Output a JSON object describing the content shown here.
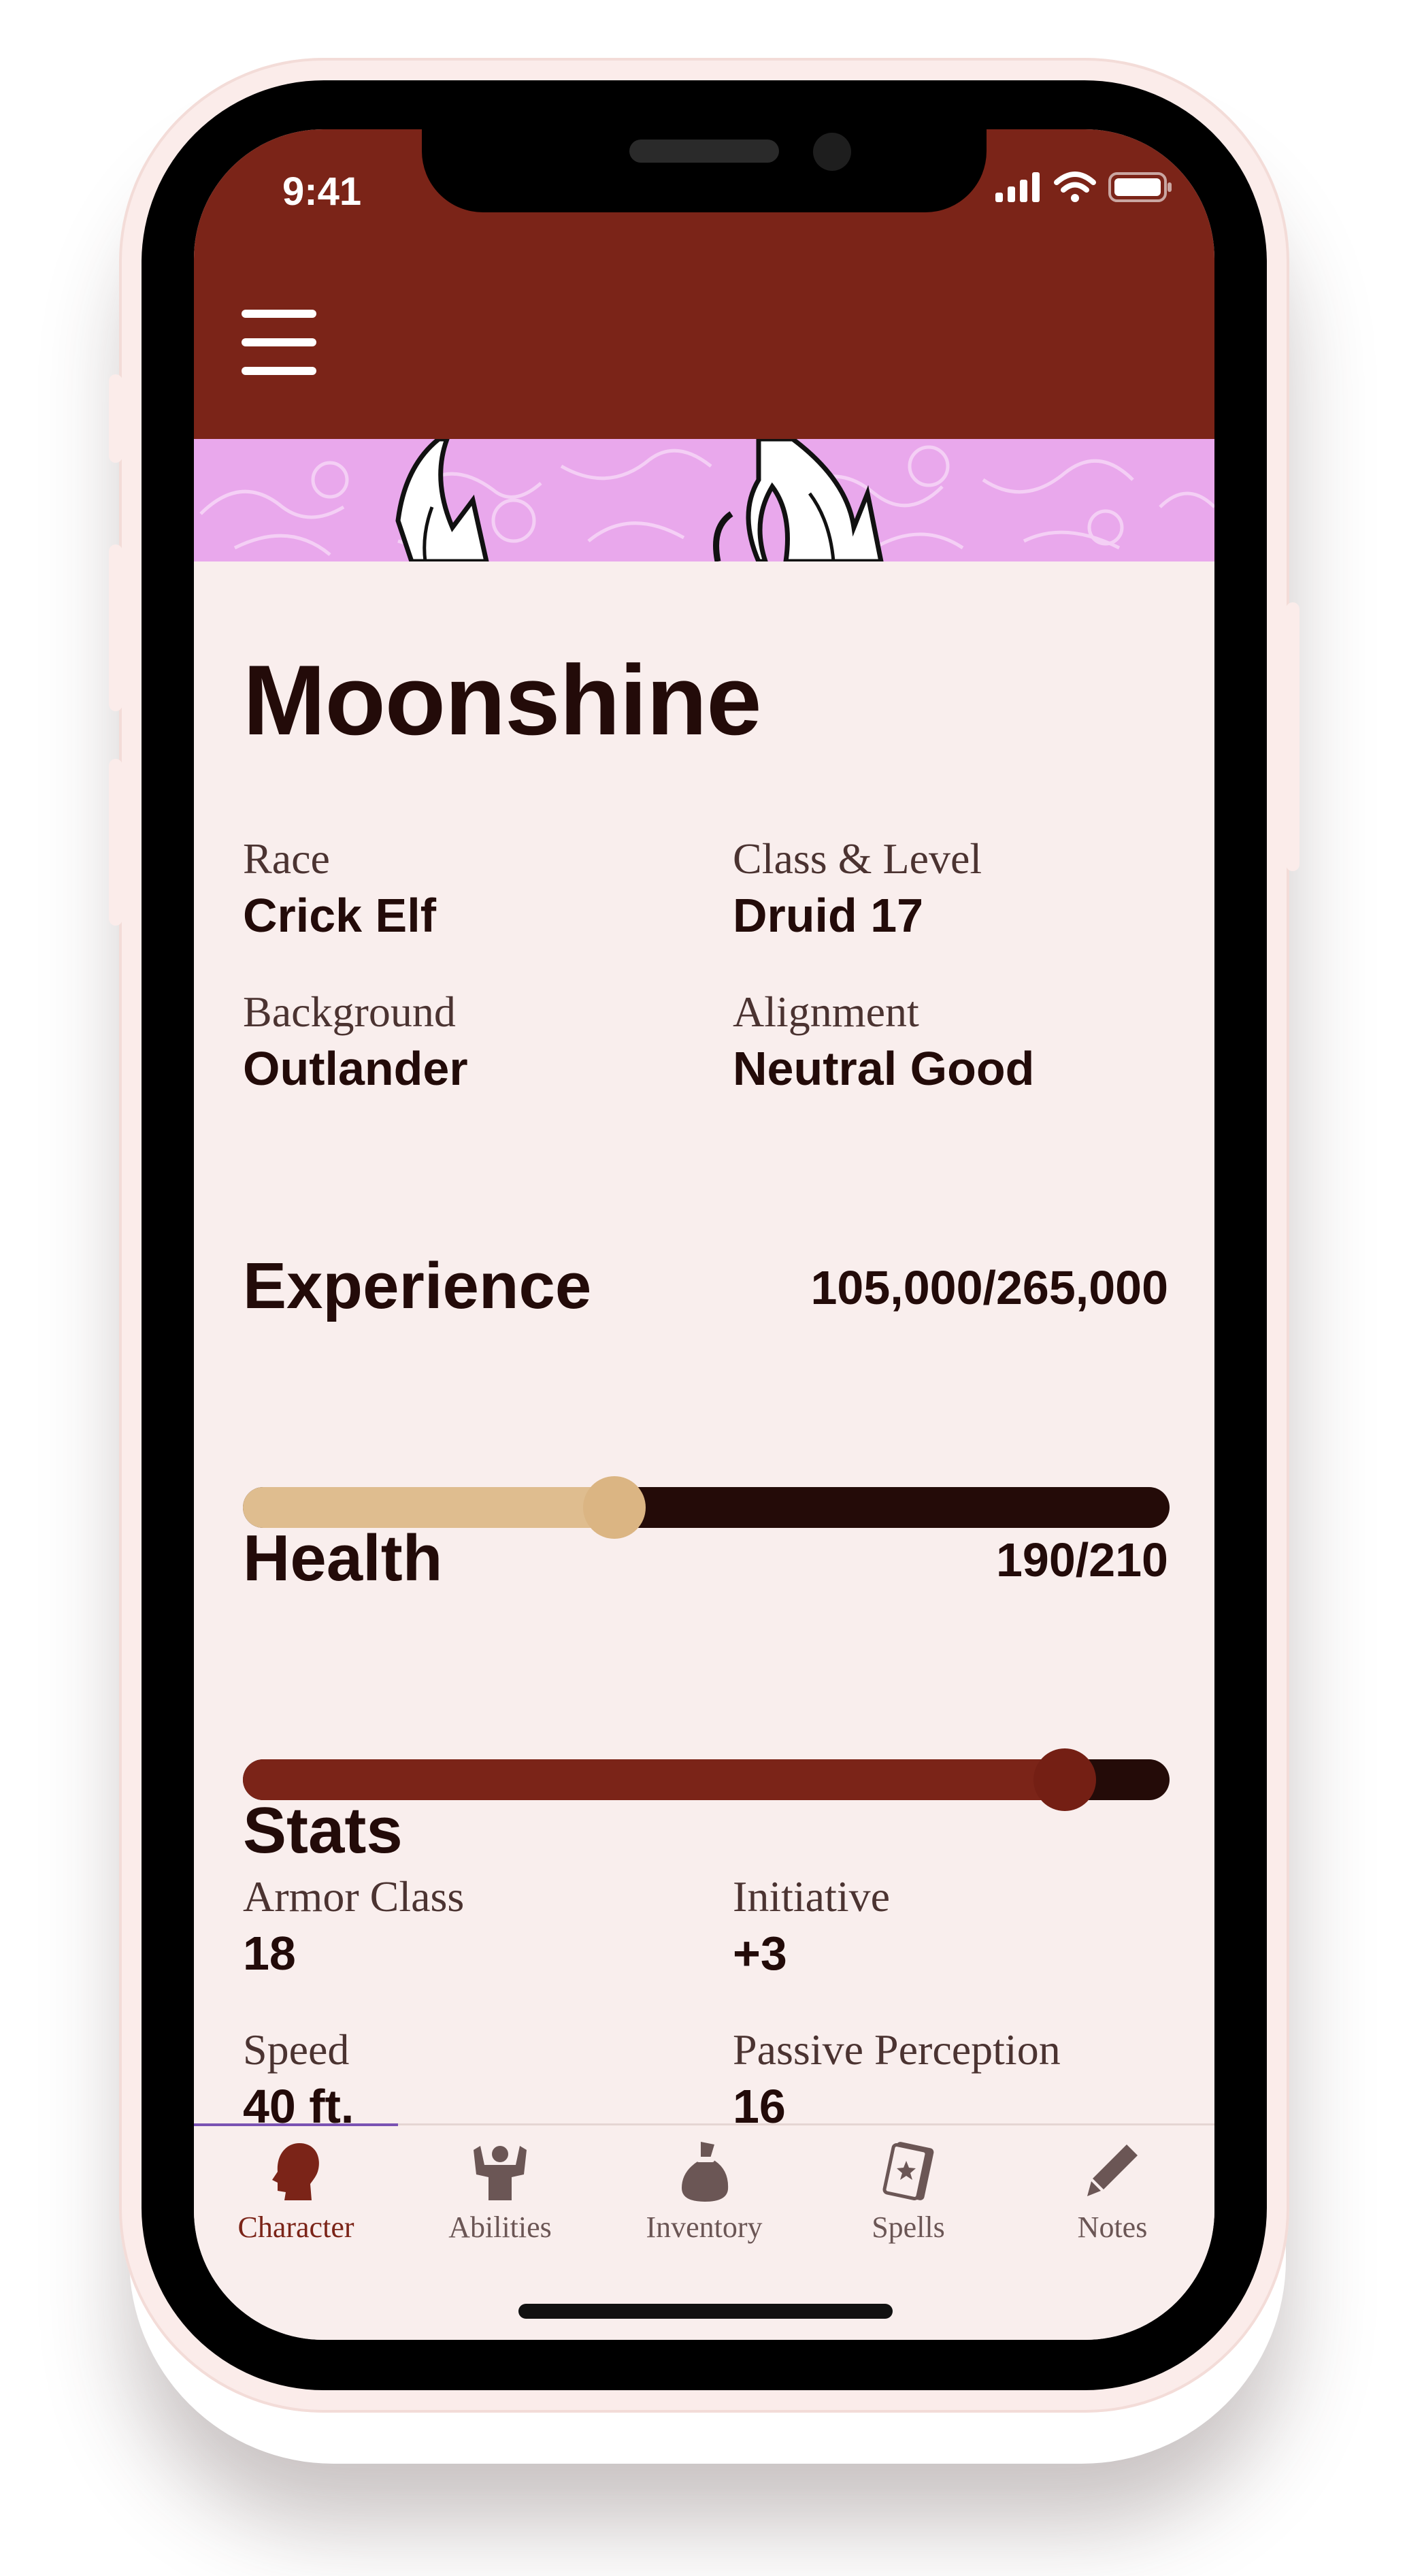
{
  "status_bar": {
    "time": "9:41"
  },
  "character": {
    "name": "Moonshine",
    "details": [
      {
        "label": "Race",
        "value": "Crick Elf"
      },
      {
        "label": "Class & Level",
        "value": "Druid 17"
      },
      {
        "label": "Background",
        "value": "Outlander"
      },
      {
        "label": "Alignment",
        "value": "Neutral Good"
      }
    ]
  },
  "experience": {
    "title": "Experience",
    "text": "105,000/265,000",
    "current": 105000,
    "max": 265000
  },
  "health": {
    "title": "Health",
    "text": "190/210",
    "current": 190,
    "max": 210
  },
  "stats": {
    "title": "Stats",
    "items": [
      {
        "label": "Armor Class",
        "value": "18"
      },
      {
        "label": "Initiative",
        "value": "+3"
      },
      {
        "label": "Speed",
        "value": "40 ft."
      },
      {
        "label": "Passive Perception",
        "value": "16"
      }
    ]
  },
  "tabs": [
    {
      "label": "Character",
      "icon": "head-silhouette-icon",
      "active": true
    },
    {
      "label": "Abilities",
      "icon": "muscles-icon",
      "active": false
    },
    {
      "label": "Inventory",
      "icon": "loot-bag-icon",
      "active": false
    },
    {
      "label": "Spells",
      "icon": "spellbook-icon",
      "active": false
    },
    {
      "label": "Notes",
      "icon": "pencil-icon",
      "active": false
    }
  ],
  "colors": {
    "header": "#7b2418",
    "background": "#f9eeed",
    "text": "#230b09",
    "experience_fill": "#dfbd8f",
    "health_fill": "#7b2418",
    "track": "#240b08",
    "banner": "#e9a8ec"
  }
}
